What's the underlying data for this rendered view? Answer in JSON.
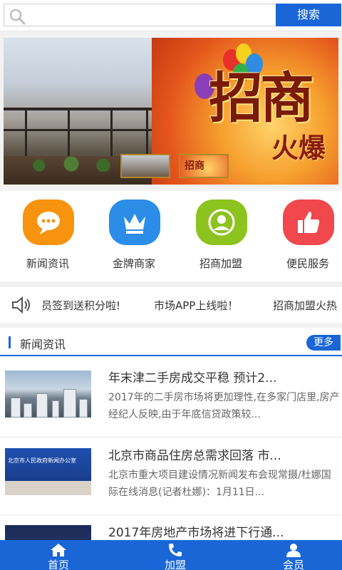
{
  "search": {
    "placeholder": "",
    "button_label": "搜索"
  },
  "banner": {
    "promo_text": "招商",
    "promo_sub": "火爆",
    "thumb2_text": "招商"
  },
  "menu": {
    "items": [
      {
        "label": "新闻资讯",
        "color": "#f7930e",
        "icon": "chat-bubble-icon"
      },
      {
        "label": "金牌商家",
        "color": "#2b8de8",
        "icon": "crown-icon"
      },
      {
        "label": "招商加盟",
        "color": "#8cc31e",
        "icon": "user-circle-icon"
      },
      {
        "label": "便民服务",
        "color": "#f0484c",
        "icon": "thumbs-up-icon"
      }
    ]
  },
  "ticker": {
    "items": [
      "员签到送积分啦!",
      "市场APP上线啦！",
      "招商加盟火热"
    ]
  },
  "news": {
    "title": "新闻资讯",
    "more_label": "更多",
    "items": [
      {
        "title": "年末津二手房成交平稳 预计2...",
        "desc": "2017年的二手房市场将更加理性,在多家门店里,房产经纪人反映,由于年底信贷政策较..."
      },
      {
        "title": "北京市商品住房总需求回落 市...",
        "desc": "北京市重大项目建设情况新闻发布会现常摄/杜娜国际在线消息(记者杜娜)：1月11日..."
      },
      {
        "title": "2017年房地产市场将进下行通...",
        "desc": ""
      }
    ],
    "press_caption": "北京市人民政府新闻办公室"
  },
  "bottom_nav": {
    "items": [
      {
        "label": "首页"
      },
      {
        "label": "加盟"
      },
      {
        "label": "会员"
      }
    ]
  },
  "colors": {
    "accent": "#1a66d6"
  }
}
